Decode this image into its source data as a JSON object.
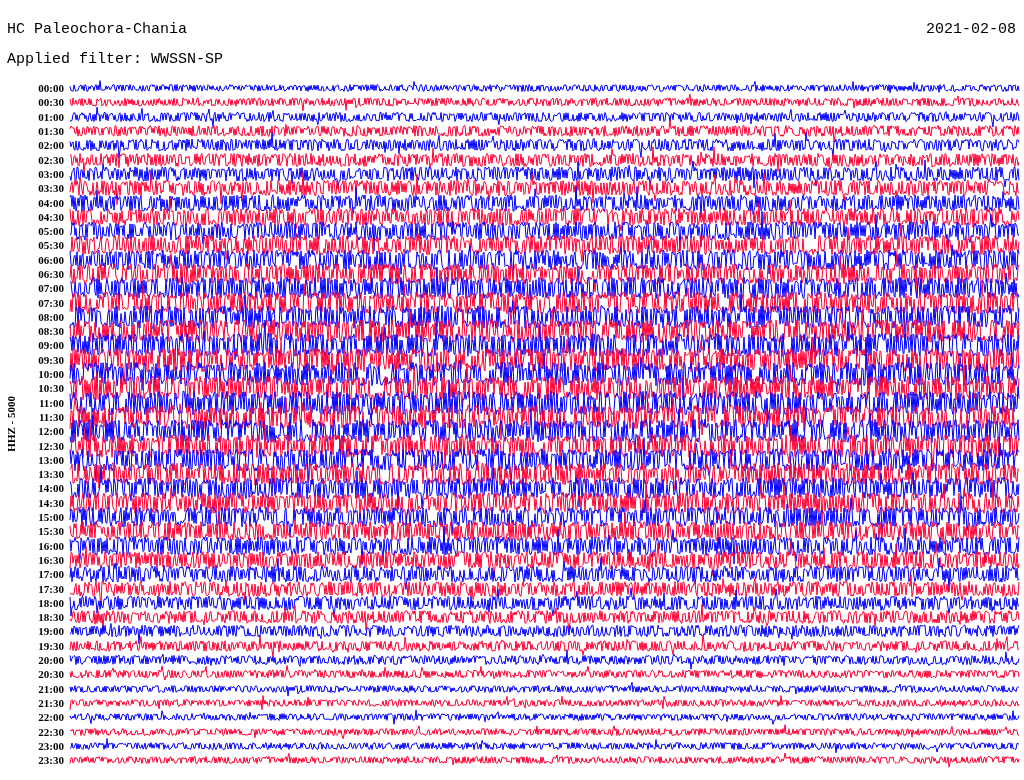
{
  "title": "HC Paleochora-Chania",
  "date": "2021-02-08",
  "filter": "Applied filter: WWSSN-SP",
  "channel_label": "HHZ - 5000",
  "rows": [
    {
      "time": "00:00",
      "color": "#0000ff"
    },
    {
      "time": "00:30",
      "color": "#ff0033"
    },
    {
      "time": "01:00",
      "color": "#0000ff"
    },
    {
      "time": "01:30",
      "color": "#ff0033"
    },
    {
      "time": "02:00",
      "color": "#0000ff"
    },
    {
      "time": "02:30",
      "color": "#ff0033"
    },
    {
      "time": "03:00",
      "color": "#0000ff"
    },
    {
      "time": "03:30",
      "color": "#ff0033"
    },
    {
      "time": "04:00",
      "color": "#0000ff"
    },
    {
      "time": "04:30",
      "color": "#ff0033"
    },
    {
      "time": "05:00",
      "color": "#0000ff"
    },
    {
      "time": "05:30",
      "color": "#ff0033"
    },
    {
      "time": "06:00",
      "color": "#0000ff"
    },
    {
      "time": "06:30",
      "color": "#ff0033"
    },
    {
      "time": "07:00",
      "color": "#0000ff"
    },
    {
      "time": "07:30",
      "color": "#ff0033"
    },
    {
      "time": "08:00",
      "color": "#0000ff"
    },
    {
      "time": "08:30",
      "color": "#ff0033"
    },
    {
      "time": "09:00",
      "color": "#0000ff"
    },
    {
      "time": "09:30",
      "color": "#ff0033"
    },
    {
      "time": "10:00",
      "color": "#0000ff"
    },
    {
      "time": "10:30",
      "color": "#ff0033"
    },
    {
      "time": "11:00",
      "color": "#0000ff"
    },
    {
      "time": "11:30",
      "color": "#ff0033"
    },
    {
      "time": "12:00",
      "color": "#0000ff"
    },
    {
      "time": "12:30",
      "color": "#ff0033"
    },
    {
      "time": "13:00",
      "color": "#0000ff"
    },
    {
      "time": "13:30",
      "color": "#ff0033"
    },
    {
      "time": "14:00",
      "color": "#0000ff"
    },
    {
      "time": "14:30",
      "color": "#ff0033"
    },
    {
      "time": "15:00",
      "color": "#0000ff"
    },
    {
      "time": "15:30",
      "color": "#ff0033"
    },
    {
      "time": "16:00",
      "color": "#0000ff"
    },
    {
      "time": "16:30",
      "color": "#ff0033"
    },
    {
      "time": "17:00",
      "color": "#0000ff"
    },
    {
      "time": "17:30",
      "color": "#ff0033"
    },
    {
      "time": "18:00",
      "color": "#0000ff"
    },
    {
      "time": "18:30",
      "color": "#ff0033"
    },
    {
      "time": "19:00",
      "color": "#0000ff"
    },
    {
      "time": "19:30",
      "color": "#ff0033"
    },
    {
      "time": "20:00",
      "color": "#0000ff"
    },
    {
      "time": "20:30",
      "color": "#ff0033"
    },
    {
      "time": "21:00",
      "color": "#0000ff"
    },
    {
      "time": "21:30",
      "color": "#ff0033"
    },
    {
      "time": "22:00",
      "color": "#0000ff"
    },
    {
      "time": "22:30",
      "color": "#ff0033"
    },
    {
      "time": "23:00",
      "color": "#0000ff"
    },
    {
      "time": "23:30",
      "color": "#ff0033"
    }
  ]
}
